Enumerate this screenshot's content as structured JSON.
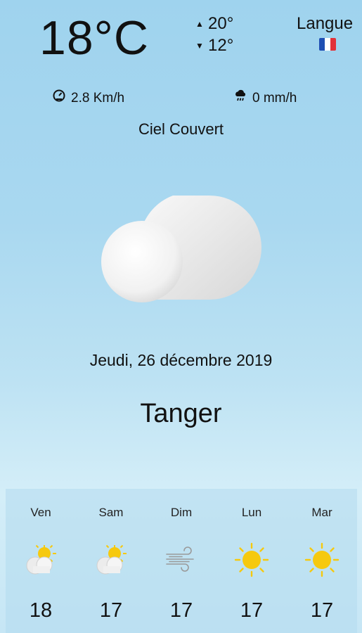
{
  "current": {
    "temperature": "18°C",
    "max": "20°",
    "min": "12°",
    "wind": "2.8 Km/h",
    "precipitation": "0 mm/h",
    "condition": "Ciel Couvert",
    "icon": "cloudy-icon"
  },
  "language": {
    "label": "Langue",
    "flag": "france-flag-icon"
  },
  "date": "Jeudi, 26 décembre 2019",
  "city": "Tanger",
  "forecast": [
    {
      "day": "Ven",
      "temp": "18",
      "icon": "partly-cloudy-icon"
    },
    {
      "day": "Sam",
      "temp": "17",
      "icon": "partly-cloudy-icon"
    },
    {
      "day": "Dim",
      "temp": "17",
      "icon": "wind-icon"
    },
    {
      "day": "Lun",
      "temp": "17",
      "icon": "sun-icon"
    },
    {
      "day": "Mar",
      "temp": "17",
      "icon": "sun-icon"
    }
  ],
  "colors": {
    "sun": "#f6c90e",
    "flag_blue": "#1f4fb3",
    "flag_white": "#ffffff",
    "flag_red": "#e2323a"
  }
}
